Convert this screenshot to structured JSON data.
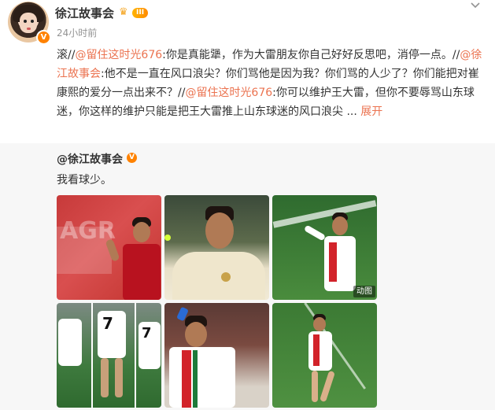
{
  "header": {
    "username": "徐江故事会",
    "level_badge": "III",
    "time": "24小时前",
    "verified_glyph": "V",
    "menu_icon": "chevron-down-icon"
  },
  "post": {
    "segments": [
      {
        "type": "text",
        "text": "滚//"
      },
      {
        "type": "link",
        "text": "@留住这时光676"
      },
      {
        "type": "text",
        "text": ":你是真能犟，作为大雷朋友你自己好好反思吧，消停一点。//"
      },
      {
        "type": "link",
        "text": "@徐江故事会"
      },
      {
        "type": "text",
        "text": ":他不是一直在风口浪尖？你们骂他是因为我？你们骂的人少了？你们能把对崔康熙的爱分一点出来不？//"
      },
      {
        "type": "link",
        "text": "@留住这时光676"
      },
      {
        "type": "text",
        "text": ":你可以维护王大雷，但你不要辱骂山东球迷，你这样的维护只能是把王大雷推上山东球迷的风口浪尖 ... "
      },
      {
        "type": "more",
        "text": "展开"
      }
    ]
  },
  "retweet": {
    "user": "@徐江故事会",
    "verified_glyph": "V",
    "text": "我看球少。",
    "images": [
      {
        "name": "image-1",
        "gif": false
      },
      {
        "name": "image-2",
        "gif": false
      },
      {
        "name": "image-3",
        "gif": true,
        "gif_label": "动图"
      },
      {
        "name": "image-4",
        "gif": false
      },
      {
        "name": "image-5",
        "gif": false
      },
      {
        "name": "image-6",
        "gif": false
      }
    ]
  },
  "colors": {
    "link": "#eb7350",
    "accent_orange": "#ff8200",
    "retweet_bg": "#f7f7f7"
  }
}
